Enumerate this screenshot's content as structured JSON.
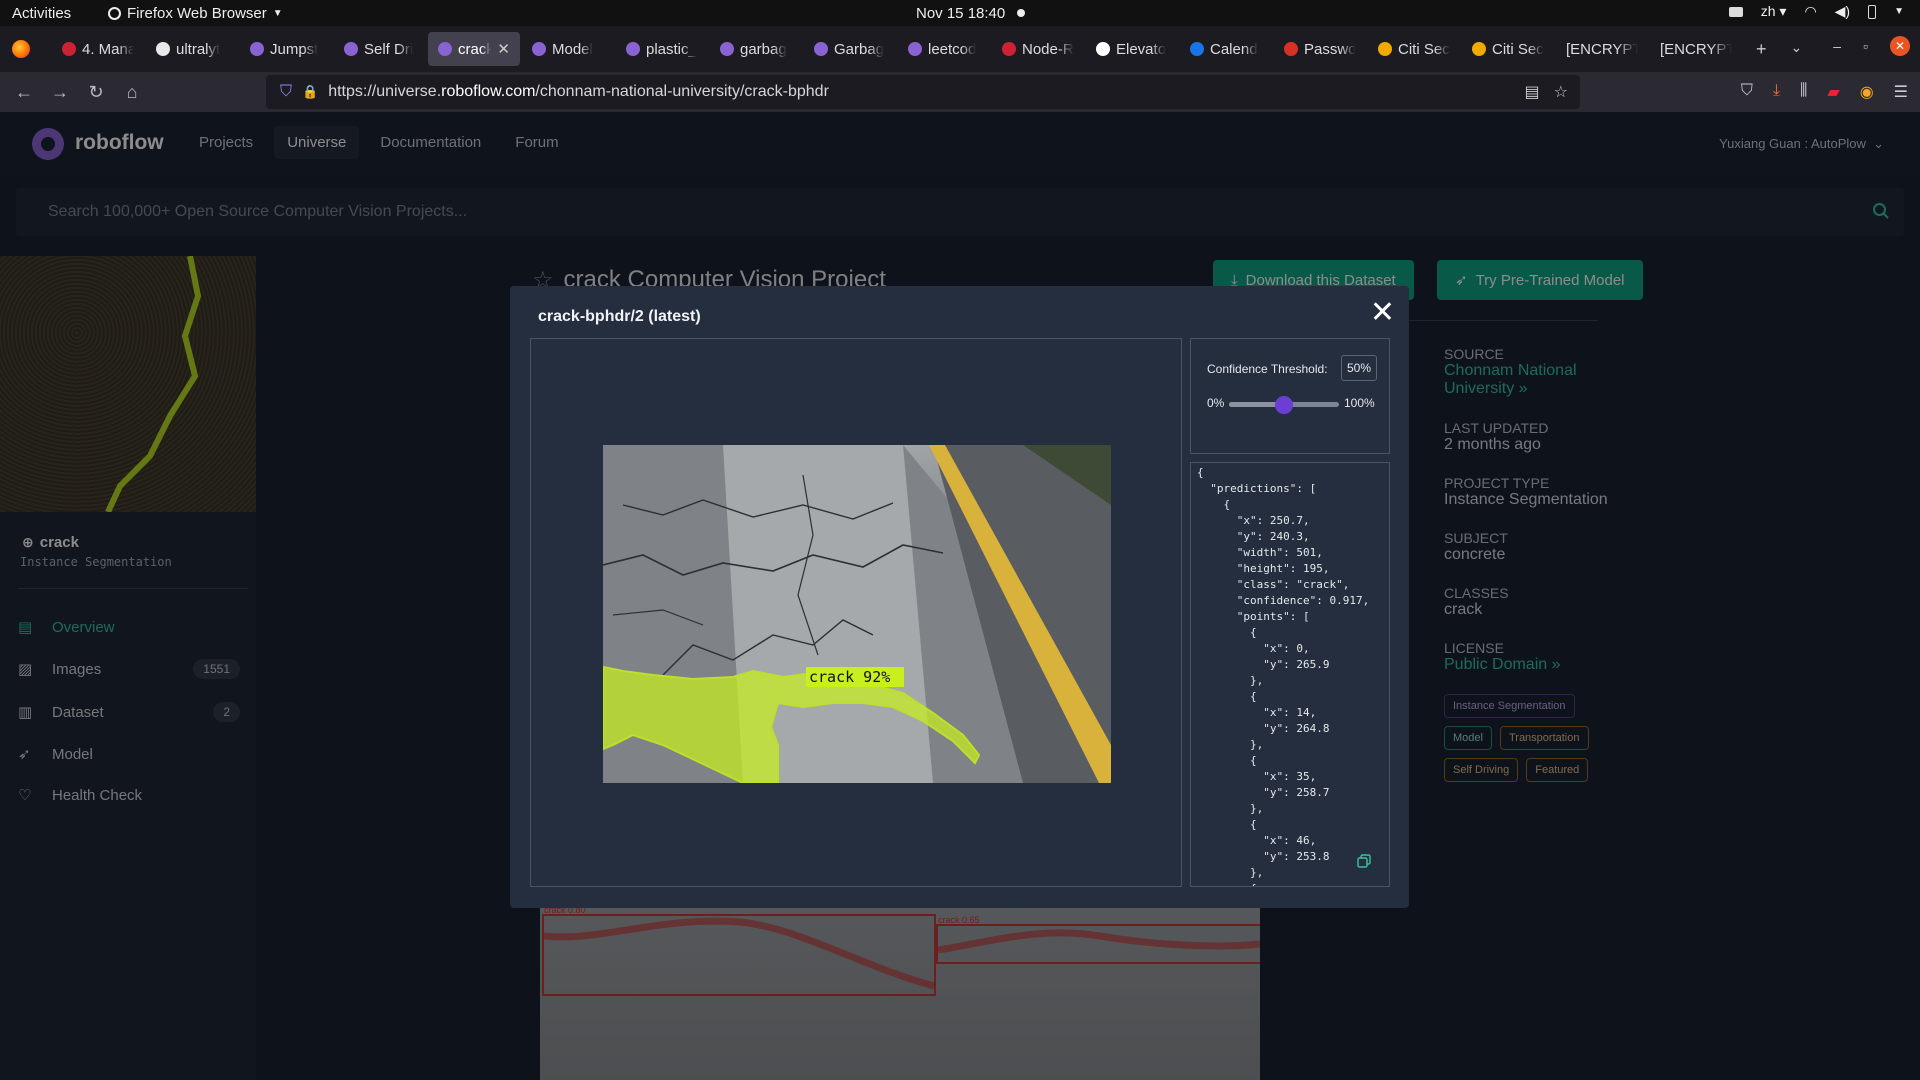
{
  "system_bar": {
    "activities": "Activities",
    "app_name": "Firefox Web Browser",
    "clock": "Nov 15  18:40",
    "input_method": "zh"
  },
  "tabs": [
    {
      "label": "4. Mana",
      "fav_color": "#cc2233"
    },
    {
      "label": "ultralyt",
      "fav_color": "#e8e8e8"
    },
    {
      "label": "Jumpst",
      "fav_color": "#8a63d2"
    },
    {
      "label": "Self Dri",
      "fav_color": "#8a63d2"
    },
    {
      "label": "crack",
      "fav_color": "#8a63d2",
      "active": true
    },
    {
      "label": "Model",
      "fav_color": "#8a63d2"
    },
    {
      "label": "plastic_",
      "fav_color": "#8a63d2"
    },
    {
      "label": "garbag",
      "fav_color": "#8a63d2"
    },
    {
      "label": "Garbag",
      "fav_color": "#8a63d2"
    },
    {
      "label": "leetcod",
      "fav_color": "#8a63d2"
    },
    {
      "label": "Node-R",
      "fav_color": "#cc2233"
    },
    {
      "label": "Elevato",
      "fav_color": "#ffffff"
    },
    {
      "label": "Calend",
      "fav_color": "#1a73e8"
    },
    {
      "label": "Passwo",
      "fav_color": "#d93025"
    },
    {
      "label": "Citi Sec",
      "fav_color": "#f2a900"
    },
    {
      "label": "Citi Sec",
      "fav_color": "#f2a900"
    },
    {
      "label": "[ENCRYPT",
      "fav_color": ""
    },
    {
      "label": "[ENCRYPT",
      "fav_color": ""
    }
  ],
  "urlbar": {
    "prefix": "https://universe.",
    "domain": "roboflow.com",
    "path": "/chonnam-national-university/crack-bphdr"
  },
  "header": {
    "brand": "roboflow",
    "nav": [
      "Projects",
      "Universe",
      "Documentation",
      "Forum"
    ],
    "active_nav": "Universe",
    "user": "Yuxiang Guan : AutoPlow"
  },
  "search": {
    "placeholder": "Search 100,000+ Open Source Computer Vision Projects..."
  },
  "sidebar": {
    "project_name": "crack",
    "project_type": "Instance Segmentation",
    "items": [
      {
        "label": "Overview",
        "count": ""
      },
      {
        "label": "Images",
        "count": "1551"
      },
      {
        "label": "Dataset",
        "count": "2"
      },
      {
        "label": "Model",
        "count": ""
      },
      {
        "label": "Health Check",
        "count": ""
      }
    ]
  },
  "main": {
    "title": "crack Computer Vision Project",
    "download_btn": "Download this Dataset",
    "try_btn": "Try Pre-Trained Model",
    "source_label": "SOURCE",
    "source_value": "Chonnam National University »",
    "updated_label": "LAST UPDATED",
    "updated_value": "2 months ago",
    "type_label": "PROJECT TYPE",
    "type_value": "Instance Segmentation",
    "subject_label": "SUBJECT",
    "subject_value": "concrete",
    "classes_label": "CLASSES",
    "classes_value": "crack",
    "license_label": "LICENSE",
    "license_value": "Public Domain »",
    "tags": [
      {
        "label": "Instance Segmentation",
        "style": "purple"
      },
      {
        "label": "Model",
        "style": "teal"
      },
      {
        "label": "Transportation",
        "style": "orange"
      },
      {
        "label": "Self Driving",
        "style": "orange"
      },
      {
        "label": "Featured",
        "style": "orange"
      }
    ],
    "preview_labels": [
      "crack 0.80",
      "crack 0.65"
    ]
  },
  "modal": {
    "title": "crack-bphdr/2 (latest)",
    "prediction_label": "crack 92%",
    "confidence_label": "Confidence Threshold:",
    "confidence_value": "50%",
    "confidence_fraction": 0.5,
    "slider_min": "0%",
    "slider_max": "100%",
    "json_text": "{\n  \"predictions\": [\n    {\n      \"x\": 250.7,\n      \"y\": 240.3,\n      \"width\": 501,\n      \"height\": 195,\n      \"class\": \"crack\",\n      \"confidence\": 0.917,\n      \"points\": [\n        {\n          \"x\": 0,\n          \"y\": 265.9\n        },\n        {\n          \"x\": 14,\n          \"y\": 264.8\n        },\n        {\n          \"x\": 35,\n          \"y\": 258.7\n        },\n        {\n          \"x\": 46,\n          \"y\": 253.8\n        },\n        {"
  }
}
